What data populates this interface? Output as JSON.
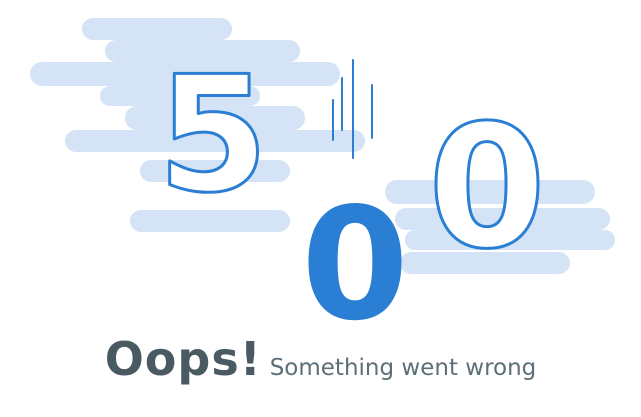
{
  "error": {
    "digits": [
      "5",
      "0",
      "0"
    ]
  },
  "message": {
    "headline": "Oops!",
    "subtitle": "Something went wrong"
  },
  "colors": {
    "accent": "#2a7fd4",
    "cloud": "#d4e4f6",
    "headline": "#4a5a62",
    "subtitle": "#5d6f78"
  }
}
